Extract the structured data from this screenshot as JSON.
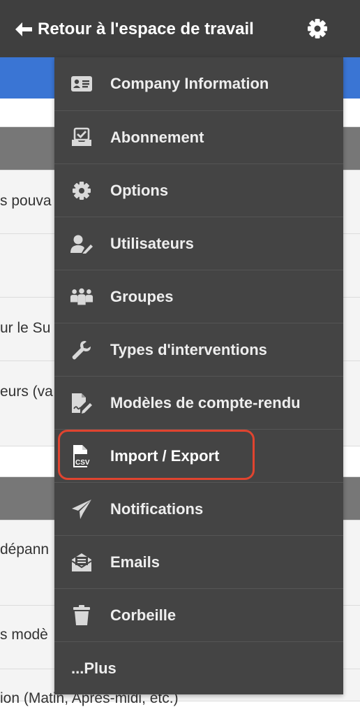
{
  "topbar": {
    "back_label": "Retour à l'espace de travail"
  },
  "background_rows": [
    "s pouva",
    "ur le Su",
    "eurs (va",
    "dépann",
    "s modè",
    "ion (Matin, Après-midi, etc.)"
  ],
  "menu": {
    "items": [
      {
        "label": "Company Information",
        "icon": "id-card-icon"
      },
      {
        "label": "Abonnement",
        "icon": "inbox-check-icon"
      },
      {
        "label": "Options",
        "icon": "gear-icon"
      },
      {
        "label": "Utilisateurs",
        "icon": "user-edit-icon"
      },
      {
        "label": "Groupes",
        "icon": "users-group-icon"
      },
      {
        "label": "Types d'interventions",
        "icon": "wrench-icon"
      },
      {
        "label": "Modèles de compte-rendu",
        "icon": "file-signature-icon"
      },
      {
        "label": "Import / Export",
        "icon": "csv-file-icon"
      },
      {
        "label": "Notifications",
        "icon": "paper-plane-icon"
      },
      {
        "label": "Emails",
        "icon": "envelope-open-icon"
      },
      {
        "label": "Corbeille",
        "icon": "trash-icon"
      },
      {
        "label": "...Plus",
        "icon": ""
      }
    ],
    "highlighted_item": "Import / Export"
  },
  "colors": {
    "topbar": "#3f3f3f",
    "accent_band": "#3a75d4",
    "menu_bg": "#444444",
    "highlight": "#e0442f"
  }
}
